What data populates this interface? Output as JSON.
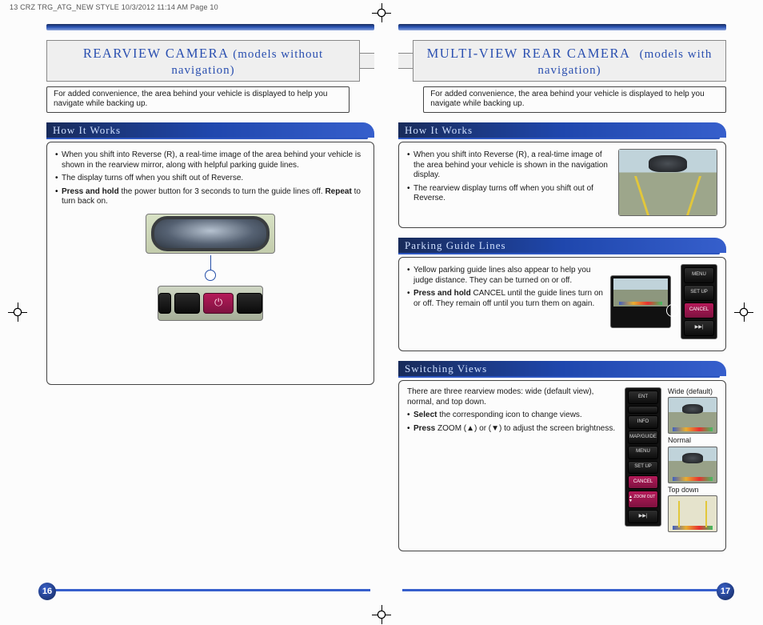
{
  "header": "13 CRZ TRG_ATG_NEW STYLE  10/3/2012  11:14 AM  Page 10",
  "left": {
    "title_main": "REARVIEW CAMERA",
    "title_sub": "(models without navigation)",
    "intro": "For added convenience, the area behind your vehicle is displayed to help you navigate while backing up.",
    "how_head": "How It Works",
    "how_b1": "When you shift into Reverse (R), a real-time image of the area behind your vehicle is shown in the rearview mirror, along with helpful parking guide lines.",
    "how_b2": "The display turns off when you shift out of Reverse.",
    "how_b3a": "Press and hold",
    "how_b3b": " the power button for 3 seconds to turn the guide lines off. ",
    "how_b3c": "Repeat",
    "how_b3d": " to turn back on.",
    "page_num": "16"
  },
  "right": {
    "title_main": "MULTI-VIEW REAR CAMERA",
    "title_sub": "(models with navigation)",
    "intro": "For added convenience, the area behind your vehicle is displayed to help you navigate while backing up.",
    "how_head": "How It Works",
    "how_b1": "When you shift into Reverse (R), a real-time image of the area behind your vehicle is shown in the navigation display.",
    "how_b2": "The rearview display turns off when you shift out of Reverse.",
    "pgl_head": "Parking Guide Lines",
    "pgl_b1": "Yellow parking guide lines also appear to help you judge distance. They can be turned on or off.",
    "pgl_b2a": "Press and hold",
    "pgl_b2b": " CANCEL until the guide lines turn on or off.  They remain off until you turn them on again.",
    "sv_head": "Switching Views",
    "sv_intro": "There are three rearview modes: wide (default view), normal, and top down.",
    "sv_b1a": "Select",
    "sv_b1b": " the corresponding icon to change views.",
    "sv_b2a": "Press",
    "sv_b2b": " ZOOM (▲) or (▼) to adjust the screen brightness.",
    "view_wide": "Wide (default)",
    "view_normal": "Normal",
    "view_top": "Top down",
    "btn_ent": "ENT",
    "btn_info": "INFO",
    "btn_map": "MAP/GUIDE",
    "btn_menu": "MENU",
    "btn_setup": "SET UP",
    "btn_cancel": "CANCEL",
    "btn_zoom": "▲ ZOOM OUT ▼",
    "btn_play": "▶▶|",
    "page_num": "17"
  }
}
